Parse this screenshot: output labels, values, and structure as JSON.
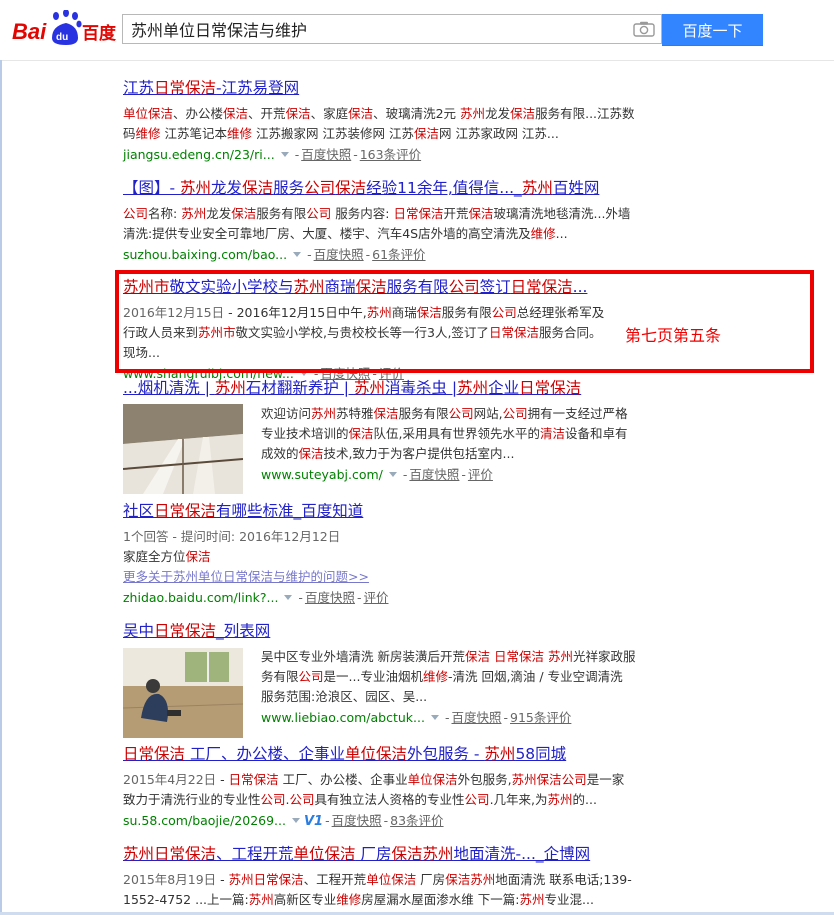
{
  "header": {
    "logo": "Bai百度",
    "query": "苏州单位日常保洁与维护",
    "search_button": "百度一下"
  },
  "results": [
    {
      "title": "江苏日常保洁-江苏易登网",
      "abstract": "单位保洁、办公楼保洁、开荒保洁、家庭保洁、玻璃清洗2元 苏州龙发保洁服务有限...江苏数码维修 江苏笔记本维修 江苏搬家网 江苏装修网 江苏保洁网 江苏家政网 江苏...",
      "url": "jiangsu.edeng.cn/23/ri...",
      "snapshot": "百度快照",
      "reviews": "163条评价"
    },
    {
      "title": "【图】- 苏州龙发保洁服务公司保洁经验11余年,值得信..._苏州百姓网",
      "abstract": "公司名称: 苏州龙发保洁服务有限公司 服务内容: 日常保洁开荒保洁玻璃清洗地毯清洗...外墙清洗:提供专业安全可靠地厂房、大厦、楼宇、汽车4S店外墙的高空清洗及维修...",
      "url": "suzhou.baixing.com/bao...",
      "snapshot": "百度快照",
      "reviews": "61条评价"
    },
    {
      "title": "苏州市敬文实验小学校与苏州商瑞保洁服务有限公司签订日常保洁...",
      "date": "2016年12月15日",
      "abstract": "2016年12月15日中午,苏州商瑞保洁服务有限公司总经理张希军及行政人员来到苏州市敬文实验小学校,与贵校校长等一行3人,签订了日常保洁服务合同。 现场...",
      "url": "www.shangruibj.com/new...",
      "snapshot": "百度快照",
      "reviews": "评价"
    },
    {
      "title": "...烟机清洗 | 苏州石材翻新养护 | 苏州消毒杀虫 |苏州企业日常保洁",
      "abstract": "欢迎访问苏州苏特雅保洁服务有限公司网站,公司拥有一支经过严格专业技术培训的保洁队伍,采用具有世界领先水平的清洁设备和卓有成效的保洁技术,致力于为客户提供包括室内...",
      "url": "www.suteyabj.com/",
      "snapshot": "百度快照",
      "reviews": "评价"
    },
    {
      "title": "社区日常保洁有哪些标准_百度知道",
      "meta": "1个回答 - 提问时间: 2016年12月12日",
      "abstract": "家庭全方位保洁",
      "more": "更多关于苏州单位日常保洁与维护的问题>>",
      "url": "zhidao.baidu.com/link?...",
      "snapshot": "百度快照",
      "reviews": "评价"
    },
    {
      "title": "吴中日常保洁_列表网",
      "abstract": "吴中区专业外墙清洗 新房装潢后开荒保洁 日常保洁 苏州光祥家政服务有限公司是一...专业油烟机维修-清洗 回烟,滴油 / 专业空调清洗 服务范围:沧浪区、园区、吴...",
      "url": "www.liebiao.com/abctuk...",
      "snapshot": "百度快照",
      "reviews": "915条评价"
    },
    {
      "title": "日常保洁 工厂、办公楼、企事业单位保洁外包服务 - 苏州58同城",
      "date": "2015年4月22日",
      "abstract": "日常保洁 工厂、办公楼、企事业单位保洁外包服务,苏州保洁公司是一家致力于清洗行业的专业性公司.公司具有独立法人资格的专业性公司.几年来,为苏州的...",
      "url": "su.58.com/baojie/20269...",
      "badge": "V1",
      "snapshot": "百度快照",
      "reviews": "83条评价"
    },
    {
      "title": "苏州日常保洁、工程开荒单位保洁 厂房保洁苏州地面清洗-..._企博网",
      "date": "2015年8月19日",
      "abstract": "苏州日常保洁、工程开荒单位保洁 厂房保洁苏州地面清洗 联系电话;139-1552-4752 ...上一篇:苏州高新区专业维修房屋漏水屋面渗水维 下一篇:苏州专业混..."
    }
  ],
  "annotation": {
    "text": "第七页第五条",
    "color": "#ee0000"
  },
  "colors": {
    "title": "#2121c9",
    "highlight": "#cc0000",
    "url": "#008000",
    "button": "#3385ff"
  }
}
